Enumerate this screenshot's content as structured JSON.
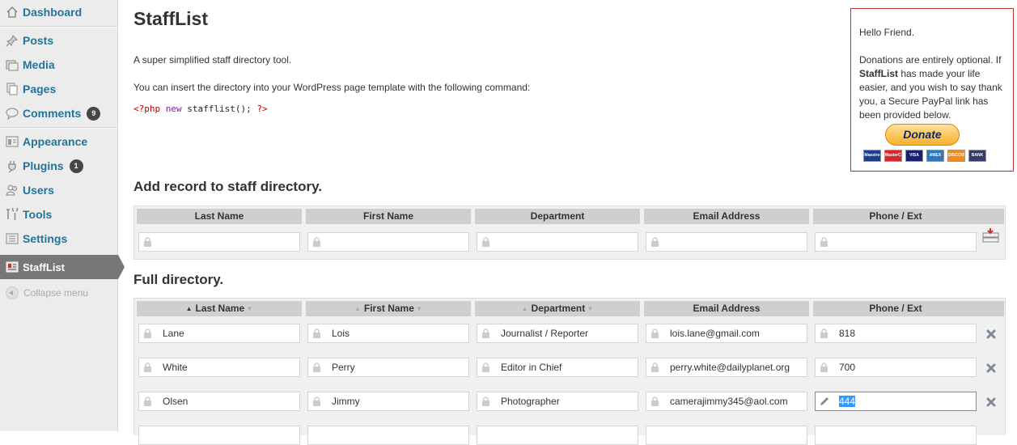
{
  "sidebar": {
    "items": [
      {
        "label": "Dashboard",
        "icon": "dashboard-icon"
      },
      {
        "label": "Posts",
        "icon": "pushpin-icon"
      },
      {
        "label": "Media",
        "icon": "media-icon"
      },
      {
        "label": "Pages",
        "icon": "pages-icon"
      },
      {
        "label": "Comments",
        "icon": "comment-icon",
        "badge": "9"
      },
      {
        "label": "Appearance",
        "icon": "appearance-icon"
      },
      {
        "label": "Plugins",
        "icon": "plug-icon",
        "badge": "1"
      },
      {
        "label": "Users",
        "icon": "users-icon"
      },
      {
        "label": "Tools",
        "icon": "tools-icon"
      },
      {
        "label": "Settings",
        "icon": "settings-icon"
      }
    ],
    "active": {
      "label": "StaffList",
      "icon": "stafflist-icon"
    },
    "collapse_label": "Collapse menu"
  },
  "main": {
    "title": "StaffList",
    "intro": "A super simplified staff directory tool.",
    "insert_text": "You can insert the directory into your WordPress page template with the following command:",
    "code": {
      "open": "<?php",
      "kw": "new",
      "call": "stafflist();",
      "close": "?>"
    }
  },
  "donate": {
    "greeting": "Hello Friend.",
    "text_before": "Donations are entirely optional. If ",
    "text_bold": "StaffList",
    "text_after": " has made your life easier, and you wish to say thank you, a Secure PayPal link has been provided below.",
    "button_label": "Donate",
    "cards": [
      {
        "label": "Maestro",
        "color": "#1a3e8c"
      },
      {
        "label": "MasterCard",
        "color": "#d8262b"
      },
      {
        "label": "VISA",
        "color": "#1a1f71"
      },
      {
        "label": "AMEX",
        "color": "#2e77bb"
      },
      {
        "label": "DISCOVER",
        "color": "#f08a24"
      },
      {
        "label": "BANK",
        "color": "#3a3a6a"
      }
    ]
  },
  "add_section": {
    "title": "Add record to staff directory.",
    "columns": [
      "Last Name",
      "First Name",
      "Department",
      "Email Address",
      "Phone / Ext"
    ]
  },
  "directory": {
    "title": "Full directory.",
    "columns": [
      "Last Name",
      "First Name",
      "Department",
      "Email Address",
      "Phone / Ext"
    ],
    "rows": [
      {
        "last": "Lane",
        "first": "Lois",
        "dept": "Journalist / Reporter",
        "email": "lois.lane@gmail.com",
        "phone": "818"
      },
      {
        "last": "White",
        "first": "Perry",
        "dept": "Editor in Chief",
        "email": "perry.white@dailyplanet.org",
        "phone": "700"
      },
      {
        "last": "Olsen",
        "first": "Jimmy",
        "dept": "Photographer",
        "email": "camerajimmy345@aol.com",
        "phone": "444"
      }
    ]
  }
}
